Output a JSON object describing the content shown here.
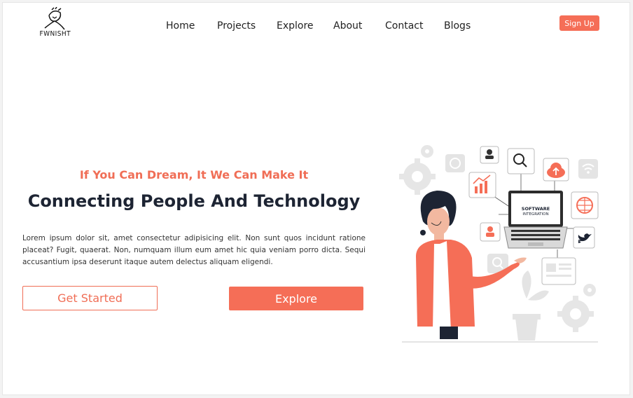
{
  "brand": {
    "logo_text": "FWNISHT"
  },
  "nav": {
    "items": [
      {
        "label": "Home"
      },
      {
        "label": "Projects"
      },
      {
        "label": "Explore"
      },
      {
        "label": "About"
      },
      {
        "label": "Contact"
      },
      {
        "label": "Blogs"
      }
    ],
    "signup_label": "Sign Up"
  },
  "hero": {
    "tagline": "If You Can Dream, It We Can Make It",
    "headline": "Connecting People And Technology",
    "description": "Lorem ipsum dolor sit, amet consectetur adipisicing elit. Non sunt quos incidunt ratione placeat? Fugit, quaerat. Non, numquam illum eum amet hic quia veniam porro dicta. Sequi accusantium ipsa deserunt itaque autem delectus aliquam eligendi.",
    "primary_button": "Get Started",
    "secondary_button": "Explore"
  },
  "illustration": {
    "screen_text_line1": "SOFTWARE",
    "screen_text_line2": "INTEGRATION"
  },
  "colors": {
    "accent": "#f56e57",
    "heading": "#1d2433",
    "icon_gray": "#e4e4e4"
  }
}
